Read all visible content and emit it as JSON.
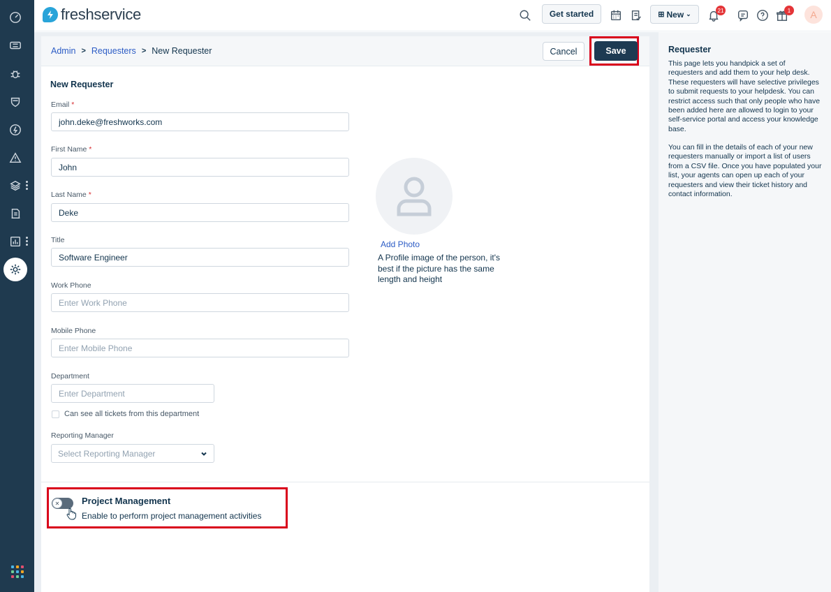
{
  "app": {
    "brand": "freshservice"
  },
  "topbar": {
    "get_started_label": "Get started",
    "new_label": "New",
    "notifications_count": "21",
    "gifts_count": "1",
    "avatar_letter": "A"
  },
  "breadcrumb": {
    "admin": "Admin",
    "requesters": "Requesters",
    "current": "New Requester"
  },
  "actions": {
    "cancel_label": "Cancel",
    "save_label": "Save"
  },
  "form": {
    "section_title": "New Requester",
    "required_mark": "*",
    "email": {
      "label": "Email",
      "value": "john.deke@freshworks.com"
    },
    "first_name": {
      "label": "First Name",
      "value": "John"
    },
    "last_name": {
      "label": "Last Name",
      "value": "Deke"
    },
    "title": {
      "label": "Title",
      "value": "Software Engineer"
    },
    "work_phone": {
      "label": "Work Phone",
      "placeholder": "Enter Work Phone"
    },
    "mobile_phone": {
      "label": "Mobile Phone",
      "placeholder": "Enter Mobile Phone"
    },
    "department": {
      "label": "Department",
      "placeholder": "Enter Department"
    },
    "dept_checkbox_label": "Can see all tickets from this department",
    "reporting_manager": {
      "label": "Reporting Manager",
      "placeholder": "Select Reporting Manager"
    }
  },
  "photo": {
    "add_label": "Add Photo",
    "help": "A Profile image of the person, it's best if the picture has the same length and height"
  },
  "project_management": {
    "title": "Project Management",
    "description": "Enable to perform project management activities",
    "enabled": false
  },
  "help_panel": {
    "title": "Requester",
    "para1": "This page lets you handpick a set of requesters and add them to your help desk. These requesters will have selective privileges to submit requests to your helpdesk. You can restrict access such that only people who have been added here are allowed to login to your self-service portal and access your knowledge base.",
    "para2": "You can fill in the details of each of your new requesters manually or import a list of users from a CSV file. Once you have populated your list, your agents can open up each of your requesters and view their ticket history and contact information."
  },
  "colors": {
    "sidebar_bg": "#1f3a4f",
    "save_button_bg": "#1d3a52",
    "link": "#2c5cc5",
    "highlight": "#d9001b",
    "badge": "#e43538"
  }
}
